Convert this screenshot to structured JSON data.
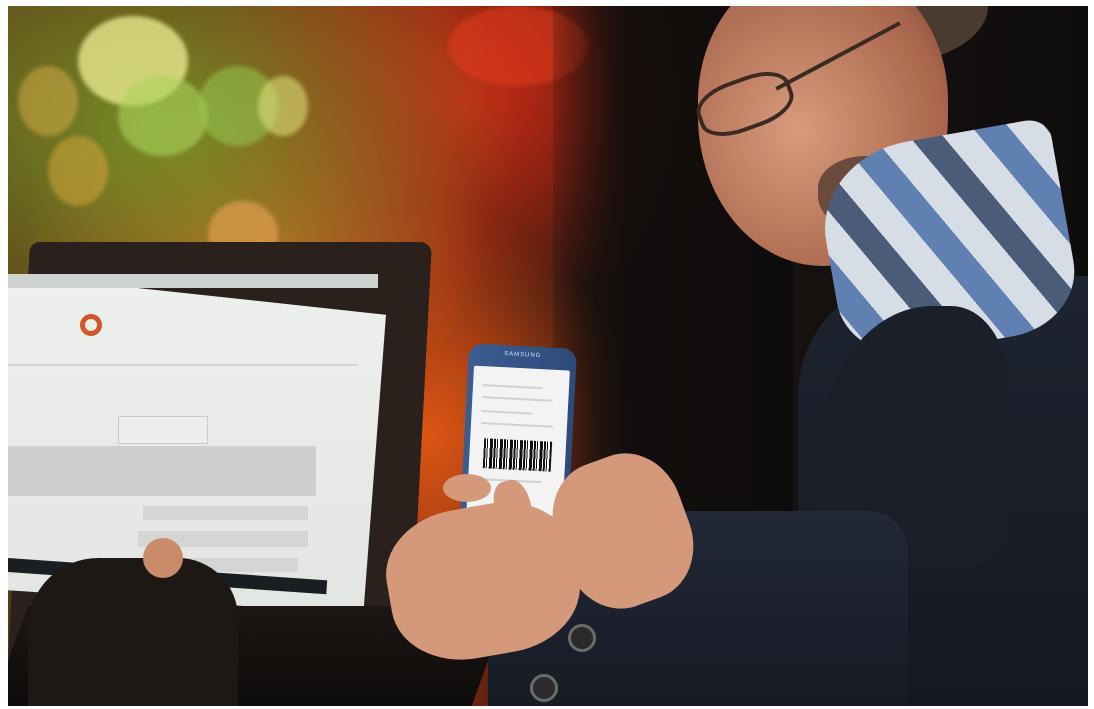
{
  "scene": {
    "description_tags": [
      "laptop",
      "smartphone",
      "barcode",
      "person",
      "bokeh-lights"
    ],
    "phone_brand": "SAMSUNG",
    "colors": {
      "bokeh_green": "#9bbf3a",
      "bokeh_red": "#c8301a",
      "bokeh_orange": "#e0702a",
      "phone_body": "#3a5d92",
      "coat": "#1e2430",
      "scarf_blue": "#5f80b0"
    }
  }
}
